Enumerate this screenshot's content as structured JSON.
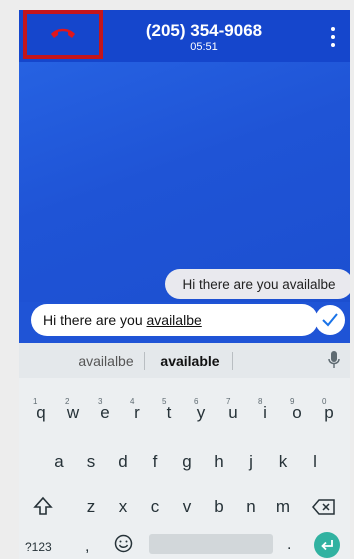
{
  "header": {
    "phone_number": "(205) 354-9068",
    "call_timer": "05:51",
    "hangup_icon": "phone-hangup-icon",
    "menu_icon": "more-vert-icon"
  },
  "conversation": {
    "bubble_text": "Hi there are you availalbe"
  },
  "compose": {
    "typed_prefix": "Hi there are you ",
    "typed_marked": "availalbe",
    "send_icon": "check-icon"
  },
  "keyboard": {
    "suggestions": [
      "availalbe",
      "available"
    ],
    "mic_icon": "mic-icon",
    "row1": [
      "q",
      "w",
      "e",
      "r",
      "t",
      "y",
      "u",
      "i",
      "o",
      "p"
    ],
    "row1_hints": [
      "1",
      "2",
      "3",
      "4",
      "5",
      "6",
      "7",
      "8",
      "9",
      "0"
    ],
    "row2": [
      "a",
      "s",
      "d",
      "f",
      "g",
      "h",
      "j",
      "k",
      "l"
    ],
    "row3": [
      "z",
      "x",
      "c",
      "v",
      "b",
      "n",
      "m"
    ],
    "shift_icon": "shift-icon",
    "backspace_icon": "backspace-icon",
    "sym_label": "?123",
    "comma": ",",
    "emoji_icon": "emoji-icon",
    "period": ".",
    "enter_icon": "enter-icon"
  },
  "colors": {
    "header": "#1546cc",
    "background": "#1f54d6",
    "hangup_highlight": "#c4151b",
    "enter_key": "#31b2a1"
  }
}
